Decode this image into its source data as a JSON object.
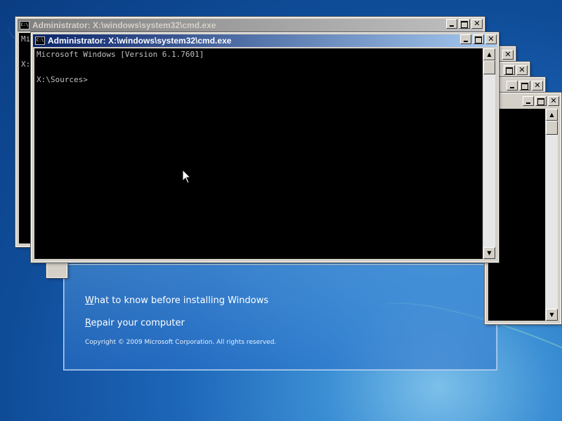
{
  "desktop": {
    "setup_window": {
      "link1_underlined_letter": "W",
      "link1_rest": "hat to know before installing Windows",
      "link2_underlined_letter": "R",
      "link2_rest": "epair your computer",
      "copyright": "Copyright © 2009 Microsoft Corporation. All rights reserved."
    }
  },
  "windows": {
    "back": {
      "title": "Administrator: X:\\windows\\system32\\cmd.exe",
      "partial_lines": [
        "Mi",
        "",
        "X:"
      ]
    },
    "front": {
      "title": "Administrator: X:\\windows\\system32\\cmd.exe",
      "icon_text": "C:\\",
      "lines": [
        "Microsoft Windows [Version 6.1.7601]",
        "",
        "X:\\Sources>"
      ]
    }
  },
  "controls": {
    "minimize": "_",
    "maximize": "□",
    "close": "✕",
    "scroll_up": "▲",
    "scroll_down": "▼"
  },
  "icons": {
    "app_icon": "cmd-icon",
    "cursor": "mouse-pointer-icon"
  }
}
